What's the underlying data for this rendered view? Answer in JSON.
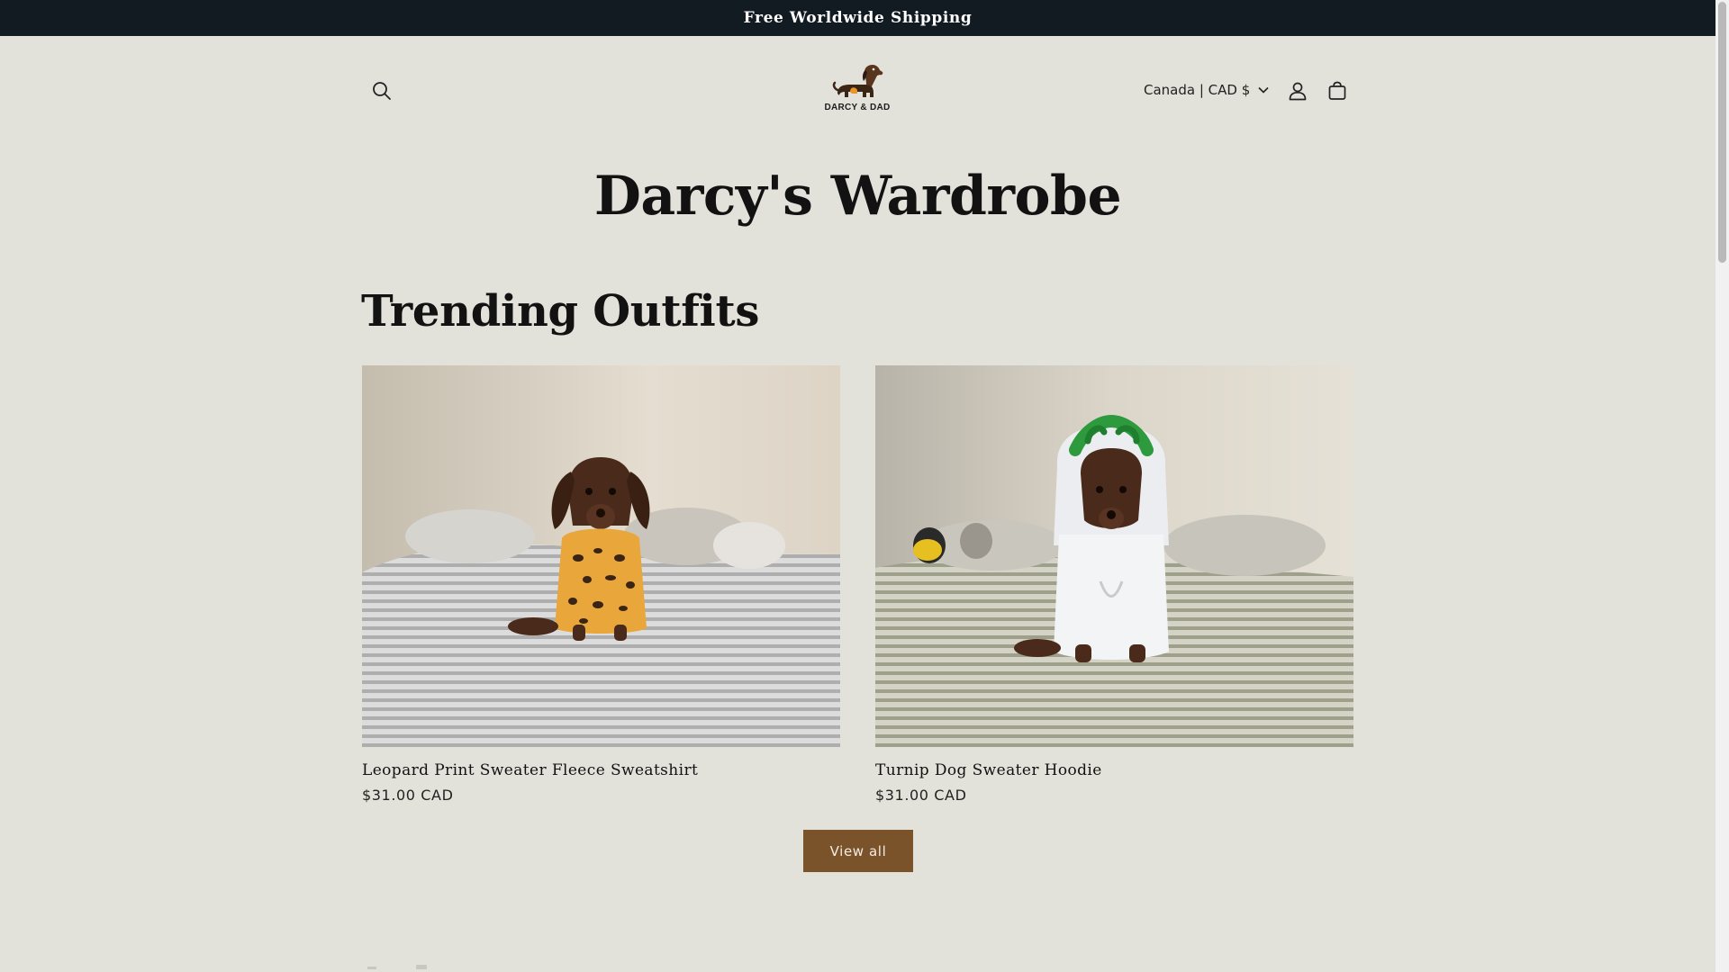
{
  "announcement": {
    "text": "Free Worldwide Shipping"
  },
  "header": {
    "logo_text": "DARCY & DAD",
    "search_icon": "search-icon",
    "locale_label": "Canada | CAD $",
    "account_icon": "user-icon",
    "cart_icon": "cart-icon"
  },
  "page": {
    "title": "Darcy's Wardrobe"
  },
  "collection": {
    "title": "Trending Outfits",
    "products": [
      {
        "title": "Leopard Print Sweater Fleece Sweatshirt",
        "price": "$31.00 CAD"
      },
      {
        "title": "Turnip Dog Sweater Hoodie",
        "price": "$31.00 CAD"
      }
    ],
    "view_all_label": "View all"
  },
  "colors": {
    "background": "#e2e1da",
    "announcement_bg": "#121a22",
    "button_bg": "#7a532a"
  }
}
